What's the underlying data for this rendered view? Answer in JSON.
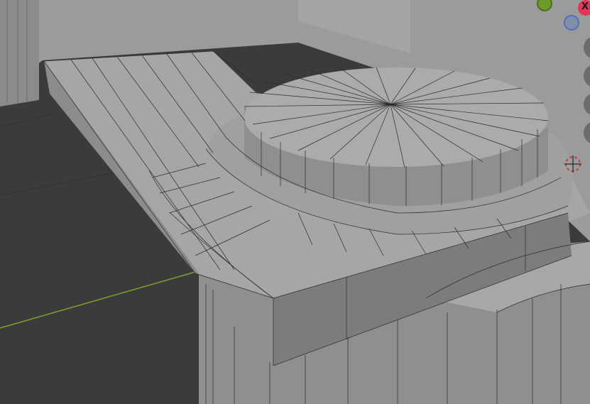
{
  "gizmo": {
    "x_label": "X",
    "colors": {
      "x_axis": "#e53555",
      "y_axis": "#6e9a2a",
      "z_axis": "#4e6fc2"
    }
  },
  "navigation": {
    "icons": [
      "zoom-icon",
      "pan-icon",
      "camera-view-icon",
      "ortho-toggle-icon"
    ]
  },
  "scene": {
    "grid_axis_color": "#7fa52b",
    "mesh_color": "#a4a4a4",
    "wire_color": "#2b2b2b",
    "cursor_color": "#d23a3a"
  }
}
